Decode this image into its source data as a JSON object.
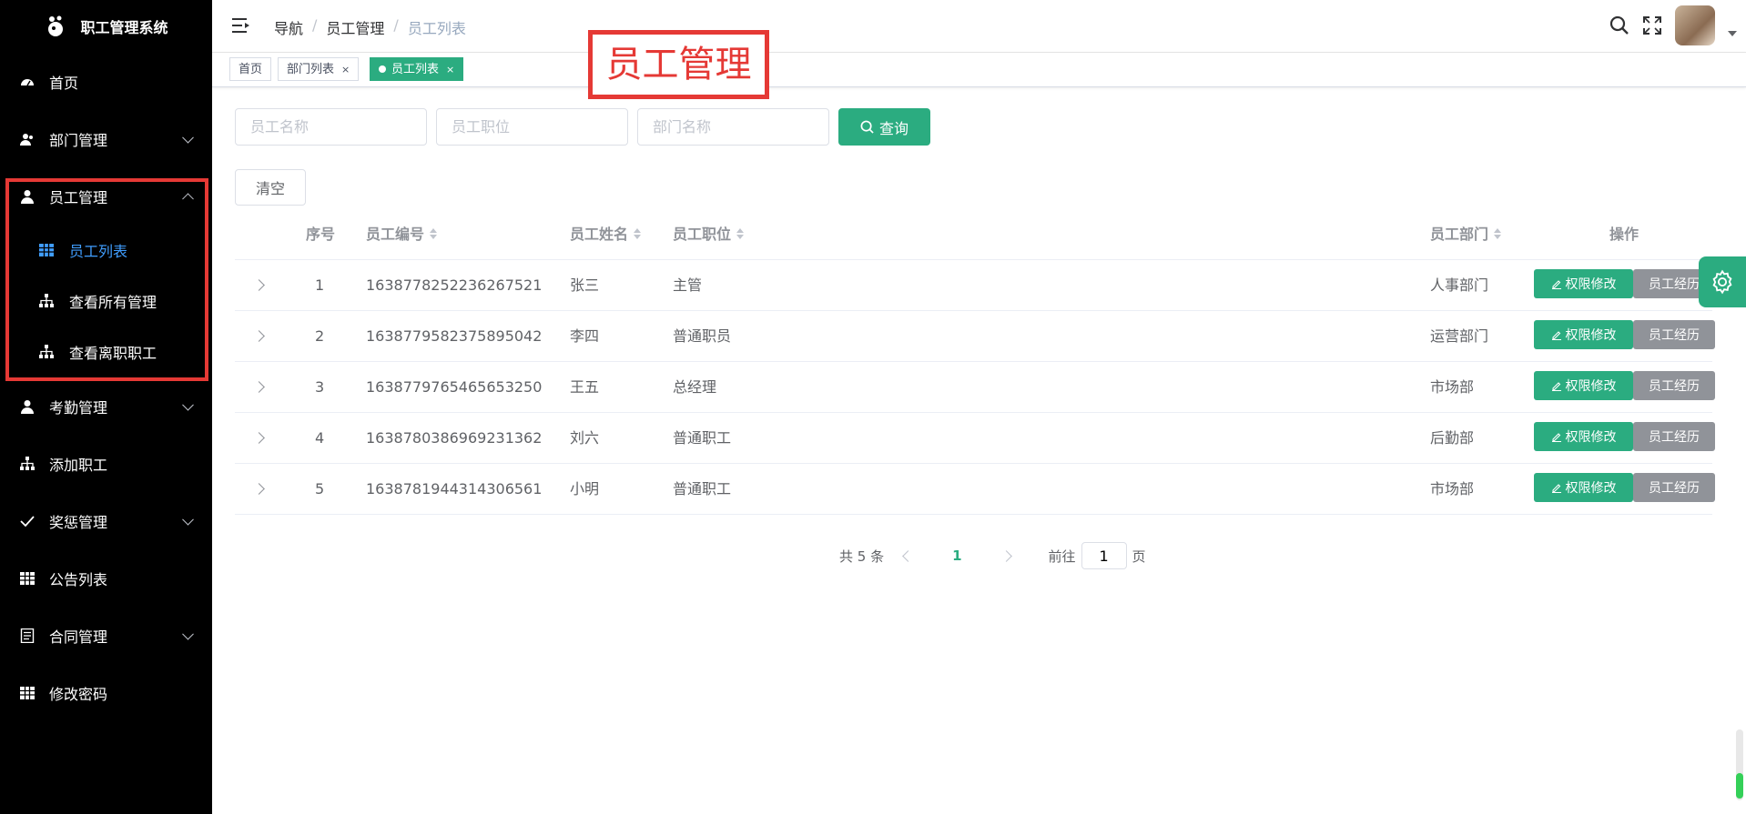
{
  "app": {
    "title": "职工管理系统"
  },
  "sidebar": {
    "items": [
      {
        "label": "首页",
        "icon": "dashboard-icon"
      },
      {
        "label": "部门管理",
        "icon": "user-group-icon",
        "expandable": true
      },
      {
        "label": "员工管理",
        "icon": "user-icon",
        "expandable": true,
        "expanded": true,
        "children": [
          {
            "label": "员工列表",
            "icon": "table-icon",
            "active": true
          },
          {
            "label": "查看所有管理",
            "icon": "org-icon"
          },
          {
            "label": "查看离职职工",
            "icon": "org-icon"
          }
        ]
      },
      {
        "label": "考勤管理",
        "icon": "user-icon",
        "expandable": true
      },
      {
        "label": "添加职工",
        "icon": "org-icon"
      },
      {
        "label": "奖惩管理",
        "icon": "check-icon",
        "expandable": true
      },
      {
        "label": "公告列表",
        "icon": "table-icon"
      },
      {
        "label": "合同管理",
        "icon": "document-icon",
        "expandable": true
      },
      {
        "label": "修改密码",
        "icon": "table-icon"
      }
    ]
  },
  "header": {
    "breadcrumb": [
      "导航",
      "员工管理",
      "员工列表"
    ]
  },
  "tags": [
    {
      "label": "首页",
      "closable": false,
      "active": false
    },
    {
      "label": "部门列表",
      "closable": true,
      "active": false
    },
    {
      "label": "员工列表",
      "closable": true,
      "active": true
    }
  ],
  "tag_close_glyph": "×",
  "annotation": {
    "text": "员工管理"
  },
  "filters": {
    "name_placeholder": "员工名称",
    "position_placeholder": "员工职位",
    "dept_placeholder": "部门名称",
    "query_label": "查询",
    "clear_label": "清空"
  },
  "table": {
    "columns": [
      "序号",
      "员工编号",
      "员工姓名",
      "员工职位",
      "员工部门",
      "操作"
    ],
    "rows": [
      {
        "index": "1",
        "id": "1638778252236267521",
        "name": "张三",
        "position": "主管",
        "dept": "人事部门"
      },
      {
        "index": "2",
        "id": "1638779582375895042",
        "name": "李四",
        "position": "普通职员",
        "dept": "运营部门"
      },
      {
        "index": "3",
        "id": "1638779765465653250",
        "name": "王五",
        "position": "总经理",
        "dept": "市场部"
      },
      {
        "index": "4",
        "id": "1638780386969231362",
        "name": "刘六",
        "position": "普通职工",
        "dept": "后勤部"
      },
      {
        "index": "5",
        "id": "1638781944314306561",
        "name": "小明",
        "position": "普通职工",
        "dept": "市场部"
      }
    ],
    "action_perm": "权限修改",
    "action_history": "员工经历"
  },
  "pagination": {
    "total_text": "共 5 条",
    "current": "1",
    "goto_prefix": "前往",
    "goto_value": "1",
    "goto_suffix": "页"
  },
  "colors": {
    "primary": "#2bac80",
    "sidebar_bg": "#000000",
    "active_menu": "#409eff",
    "annotation": "#e53935"
  }
}
